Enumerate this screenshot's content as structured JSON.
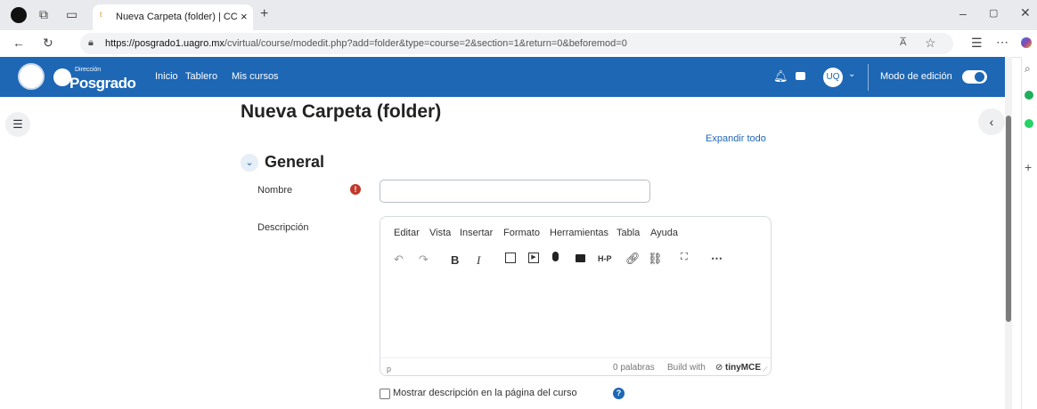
{
  "browser": {
    "tab_title": "Nueva Carpeta (folder) | CC | Plat",
    "tab_close": "×",
    "new_tab": "+",
    "url_host": "https://posgrado1.uagro.mx",
    "url_path": "/cvirtual/course/modedit.php?add=folder&type=course=2&section=1&return=0&beforemod=0",
    "reader_label": "A̅"
  },
  "navbar": {
    "brand_small": "Dirección",
    "brand_large": "Posgrado",
    "links": [
      "Inicio",
      "Tablero",
      "Mis cursos"
    ],
    "user_initials": "UQ",
    "edit_mode_label": "Modo de edición"
  },
  "page": {
    "title": "Nueva Carpeta (folder)",
    "expand_all": "Expandir todo",
    "section_general": "General",
    "name_label": "Nombre",
    "name_value": "",
    "description_label": "Descripción",
    "show_description_label": "Mostrar descripción en la página del curso"
  },
  "editor": {
    "menus": [
      "Editar",
      "Vista",
      "Insertar",
      "Formato",
      "Herramientas",
      "Tabla",
      "Ayuda"
    ],
    "status_path": "p",
    "word_count": "0 palabras",
    "build_with": "Build with",
    "brand": "tinyMCE"
  },
  "colors": {
    "navbar": "#1d67b5",
    "link": "#1d67b5",
    "required": "#c0392b"
  }
}
